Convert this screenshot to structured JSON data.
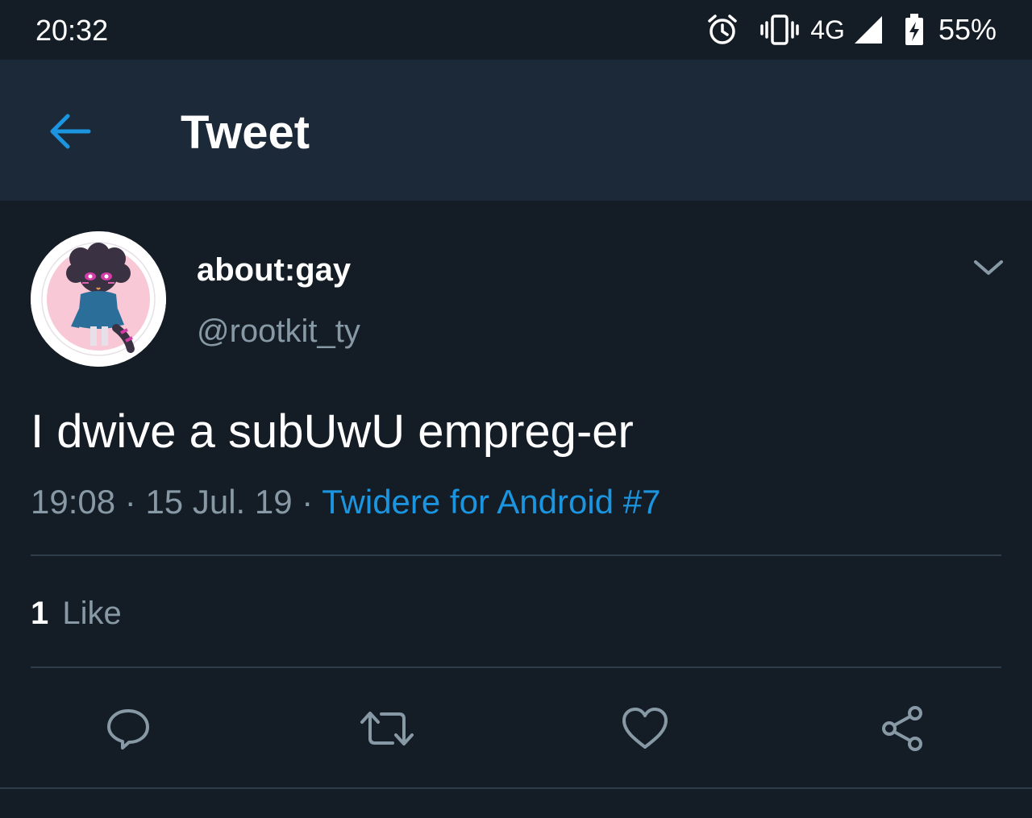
{
  "status_bar": {
    "time": "20:32",
    "network": "4G",
    "battery": "55%",
    "icons": [
      "alarm-icon",
      "vibrate-icon",
      "signal-icon",
      "battery-charging-icon"
    ]
  },
  "appbar": {
    "title": "Tweet",
    "back_icon": "arrow-left-icon"
  },
  "tweet": {
    "display_name": "about:gay",
    "handle": "@rootkit_ty",
    "text": "I dwive a subUwU empreg-er",
    "time": "19:08",
    "separator": "·",
    "date": "15 Jul. 19",
    "source": "Twidere for Android #7",
    "like_count": "1",
    "like_label": "Like"
  },
  "actions": [
    "reply-icon",
    "retweet-icon",
    "like-icon",
    "share-icon"
  ],
  "colors": {
    "background": "#141d26",
    "appbar": "#1c2938",
    "accent": "#1b95e0",
    "secondary_text": "#8899a6",
    "divider": "#2f3d4b"
  }
}
